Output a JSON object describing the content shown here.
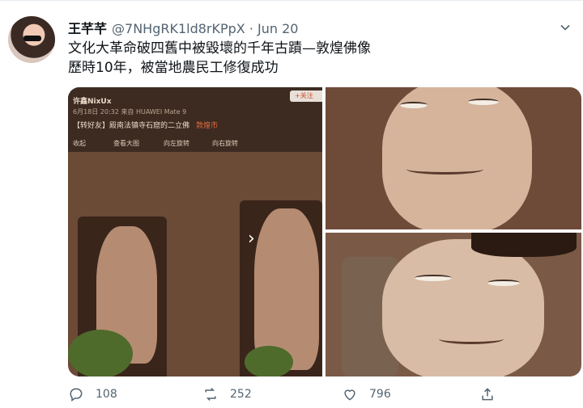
{
  "tweet": {
    "display_name": "王芊芊",
    "handle": "@7NHgRK1ld8rKPpX · Jun 20",
    "text_line1": "文化大革命破四舊中被毀壞的千年古蹟—敦煌佛像",
    "text_line2": "歷時10年，被當地農民工修復成功"
  },
  "embedded_screenshot": {
    "user": "许鑫NixUx",
    "meta": "6月18日 20:32 来自 HUAWEI Mate 9",
    "tag": "【转好友】殿南法镇寺石窟的二立佛",
    "location": "敦煌市",
    "follow": "+关注",
    "tools": [
      "收起",
      "查看大图",
      "向左旋转",
      "向右旋转"
    ]
  },
  "actions": {
    "reply_count": "108",
    "retweet_count": "252",
    "like_count": "796"
  },
  "icons": [
    "more-icon",
    "reply-icon",
    "retweet-icon",
    "like-icon",
    "share-icon"
  ],
  "colors": {
    "text": "#0f1419",
    "secondary": "#536471",
    "divider": "#e6ecf0"
  }
}
